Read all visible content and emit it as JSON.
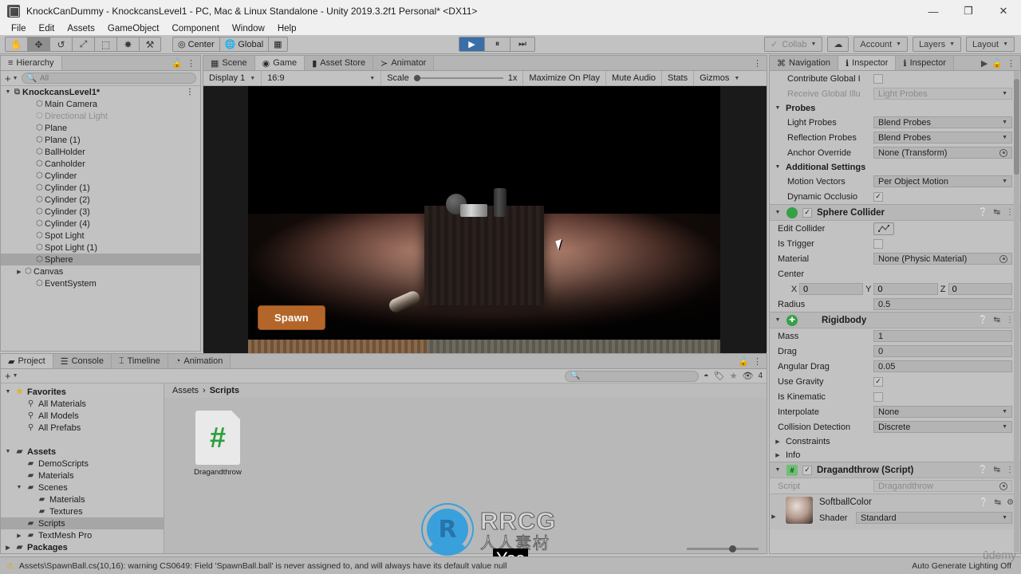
{
  "window": {
    "title": "KnockCanDummy - KnockcansLevel1 - PC, Mac & Linux Standalone - Unity 2019.3.2f1 Personal* <DX11>",
    "minimize": "—",
    "maximize": "❐",
    "close": "✕"
  },
  "menubar": [
    "File",
    "Edit",
    "Assets",
    "GameObject",
    "Component",
    "Window",
    "Help"
  ],
  "toolbar": {
    "tools": [
      {
        "name": "hand-tool",
        "glyph": "✋",
        "active": false
      },
      {
        "name": "move-tool",
        "glyph": "✥",
        "active": true
      },
      {
        "name": "rotate-tool",
        "glyph": "↺",
        "active": false
      },
      {
        "name": "scale-tool",
        "glyph": "⤢",
        "active": false
      },
      {
        "name": "rect-tool",
        "glyph": "⬚",
        "active": false
      },
      {
        "name": "transform-tool",
        "glyph": "✸",
        "active": false
      },
      {
        "name": "custom-tool",
        "glyph": "⚒",
        "active": false
      }
    ],
    "pivot_label": "Center",
    "space_label": "Global",
    "grid_snap_glyph": "▦",
    "play": "▶",
    "pause": "⏸",
    "step": "⏭",
    "collab": "Collab",
    "cloud_glyph": "☁",
    "account": "Account",
    "layers": "Layers",
    "layout": "Layout"
  },
  "hierarchy": {
    "tab": "Hierarchy",
    "tab_icon": "≡",
    "search_placeholder": "All",
    "plus": "+",
    "items": [
      {
        "label": "KnockcansLevel1*",
        "depth": 0,
        "root": true,
        "expanded": true,
        "selected": false,
        "dim": false
      },
      {
        "label": "Main Camera",
        "depth": 2,
        "root": false,
        "expanded": null,
        "selected": false,
        "dim": false
      },
      {
        "label": "Directional Light",
        "depth": 2,
        "root": false,
        "expanded": null,
        "selected": false,
        "dim": true
      },
      {
        "label": "Plane",
        "depth": 2,
        "root": false,
        "expanded": null,
        "selected": false,
        "dim": false
      },
      {
        "label": "Plane (1)",
        "depth": 2,
        "root": false,
        "expanded": null,
        "selected": false,
        "dim": false
      },
      {
        "label": "BallHolder",
        "depth": 2,
        "root": false,
        "expanded": null,
        "selected": false,
        "dim": false
      },
      {
        "label": "Canholder",
        "depth": 2,
        "root": false,
        "expanded": null,
        "selected": false,
        "dim": false
      },
      {
        "label": "Cylinder",
        "depth": 2,
        "root": false,
        "expanded": null,
        "selected": false,
        "dim": false
      },
      {
        "label": "Cylinder (1)",
        "depth": 2,
        "root": false,
        "expanded": null,
        "selected": false,
        "dim": false
      },
      {
        "label": "Cylinder (2)",
        "depth": 2,
        "root": false,
        "expanded": null,
        "selected": false,
        "dim": false
      },
      {
        "label": "Cylinder (3)",
        "depth": 2,
        "root": false,
        "expanded": null,
        "selected": false,
        "dim": false
      },
      {
        "label": "Cylinder (4)",
        "depth": 2,
        "root": false,
        "expanded": null,
        "selected": false,
        "dim": false
      },
      {
        "label": "Spot Light",
        "depth": 2,
        "root": false,
        "expanded": null,
        "selected": false,
        "dim": false
      },
      {
        "label": "Spot Light (1)",
        "depth": 2,
        "root": false,
        "expanded": null,
        "selected": false,
        "dim": false
      },
      {
        "label": "Sphere",
        "depth": 2,
        "root": false,
        "expanded": null,
        "selected": true,
        "dim": false
      },
      {
        "label": "Canvas",
        "depth": 1,
        "root": false,
        "expanded": false,
        "selected": false,
        "dim": false
      },
      {
        "label": "EventSystem",
        "depth": 2,
        "root": false,
        "expanded": null,
        "selected": false,
        "dim": false
      }
    ]
  },
  "gamepanel": {
    "tabs": [
      {
        "label": "Scene",
        "icon": "▦",
        "selected": false
      },
      {
        "label": "Game",
        "icon": "◉",
        "selected": true
      },
      {
        "label": "Asset Store",
        "icon": "▮",
        "selected": false
      },
      {
        "label": "Animator",
        "icon": "≻",
        "selected": false
      }
    ],
    "display": "Display 1",
    "aspect": "16:9",
    "scale_label": "Scale",
    "scale_value": "1x",
    "maximize_on_play": "Maximize On Play",
    "mute_audio": "Mute Audio",
    "stats": "Stats",
    "gizmos": "Gizmos",
    "spawn_button": "Spawn"
  },
  "inspector": {
    "tabs": [
      {
        "label": "Navigation",
        "icon": "⌘",
        "selected": false
      },
      {
        "label": "Inspector",
        "icon": "ℹ",
        "selected": true
      },
      {
        "label": "Inspector",
        "icon": "ℹ",
        "selected": false
      }
    ],
    "renderer_tail": {
      "contribute_global_label": "Contribute Global I",
      "receive_global_label": "Receive Global Illu",
      "receive_global_value": "Light Probes",
      "probes_header": "Probes",
      "light_probes_label": "Light Probes",
      "light_probes_value": "Blend Probes",
      "reflection_probes_label": "Reflection Probes",
      "reflection_probes_value": "Blend Probes",
      "anchor_override_label": "Anchor Override",
      "anchor_override_value": "None (Transform)",
      "additional_settings_header": "Additional Settings",
      "motion_vectors_label": "Motion Vectors",
      "motion_vectors_value": "Per Object Motion",
      "dynamic_occlusion_label": "Dynamic Occlusio",
      "dynamic_occlusion_checked": "✓"
    },
    "sphere_collider": {
      "title": "Sphere Collider",
      "enabled": "✓",
      "edit_collider_label": "Edit Collider",
      "is_trigger_label": "Is Trigger",
      "material_label": "Material",
      "material_value": "None (Physic Material)",
      "center_label": "Center",
      "center_x": "0",
      "center_y": "0",
      "center_z": "0",
      "axis_x": "X",
      "axis_y": "Y",
      "axis_z": "Z",
      "radius_label": "Radius",
      "radius_value": "0.5"
    },
    "rigidbody": {
      "title": "Rigidbody",
      "mass_label": "Mass",
      "mass_value": "1",
      "drag_label": "Drag",
      "drag_value": "0",
      "angular_drag_label": "Angular Drag",
      "angular_drag_value": "0.05",
      "use_gravity_label": "Use Gravity",
      "use_gravity_checked": "✓",
      "is_kinematic_label": "Is Kinematic",
      "interpolate_label": "Interpolate",
      "interpolate_value": "None",
      "collision_detection_label": "Collision Detection",
      "collision_detection_value": "Discrete",
      "constraints_label": "Constraints",
      "info_label": "Info"
    },
    "script_component": {
      "title": "Dragandthrow (Script)",
      "enabled": "✓",
      "script_label": "Script",
      "script_value": "Dragandthrow"
    },
    "material": {
      "name": "SoftballColor",
      "shader_label": "Shader",
      "shader_value": "Standard"
    }
  },
  "project": {
    "tabs": [
      {
        "label": "Project",
        "icon": "▰",
        "selected": true
      },
      {
        "label": "Console",
        "icon": "☰",
        "selected": false
      },
      {
        "label": "Timeline",
        "icon": "⌶",
        "selected": false
      },
      {
        "label": "Animation",
        "icon": "◔",
        "selected": false
      }
    ],
    "plus": "+",
    "tree": [
      {
        "label": "Favorites",
        "depth": 0,
        "icon": "star",
        "bold": true,
        "tri": "▼",
        "selected": false
      },
      {
        "label": "All Materials",
        "depth": 1,
        "icon": "search",
        "bold": false,
        "tri": "",
        "selected": false
      },
      {
        "label": "All Models",
        "depth": 1,
        "icon": "search",
        "bold": false,
        "tri": "",
        "selected": false
      },
      {
        "label": "All Prefabs",
        "depth": 1,
        "icon": "search",
        "bold": false,
        "tri": "",
        "selected": false
      },
      {
        "label": "",
        "depth": 0,
        "icon": "none",
        "bold": false,
        "tri": "",
        "selected": false
      },
      {
        "label": "Assets",
        "depth": 0,
        "icon": "folder-open",
        "bold": true,
        "tri": "▼",
        "selected": false
      },
      {
        "label": "DemoScripts",
        "depth": 1,
        "icon": "folder",
        "bold": false,
        "tri": "",
        "selected": false
      },
      {
        "label": "Materials",
        "depth": 1,
        "icon": "folder",
        "bold": false,
        "tri": "",
        "selected": false
      },
      {
        "label": "Scenes",
        "depth": 1,
        "icon": "folder-open",
        "bold": false,
        "tri": "▼",
        "selected": false
      },
      {
        "label": "Materials",
        "depth": 2,
        "icon": "folder",
        "bold": false,
        "tri": "",
        "selected": false
      },
      {
        "label": "Textures",
        "depth": 2,
        "icon": "folder",
        "bold": false,
        "tri": "",
        "selected": false
      },
      {
        "label": "Scripts",
        "depth": 1,
        "icon": "folder",
        "bold": false,
        "tri": "",
        "selected": true
      },
      {
        "label": "TextMesh Pro",
        "depth": 1,
        "icon": "folder",
        "bold": false,
        "tri": "▶",
        "selected": false
      },
      {
        "label": "Packages",
        "depth": 0,
        "icon": "folder",
        "bold": true,
        "tri": "▶",
        "selected": false
      }
    ],
    "breadcrumb": [
      "Assets",
      "Scripts"
    ],
    "breadcrumb_sep": "›",
    "assets": [
      {
        "label": "Dragandthrow",
        "glyph": "#"
      }
    ],
    "filter_count": "4"
  },
  "statusbar": {
    "warn_icon": "⚠",
    "message": "Assets\\SpawnBall.cs(10,16): warning CS0649: Field 'SpawnBall.ball' is never assigned to, and will always have its default value null",
    "right": "Auto Generate Lighting Off"
  },
  "watermarks": {
    "rrcg_main": "RRCG",
    "rrcg_sub": "人人素材",
    "yes": "Yes",
    "udemy": "ûdemy"
  },
  "colors": {
    "accent_play": "#3a6ea8",
    "spawn_button": "#b4662a",
    "panel_bg": "#c2c2c2",
    "warning": "#d9a521"
  }
}
